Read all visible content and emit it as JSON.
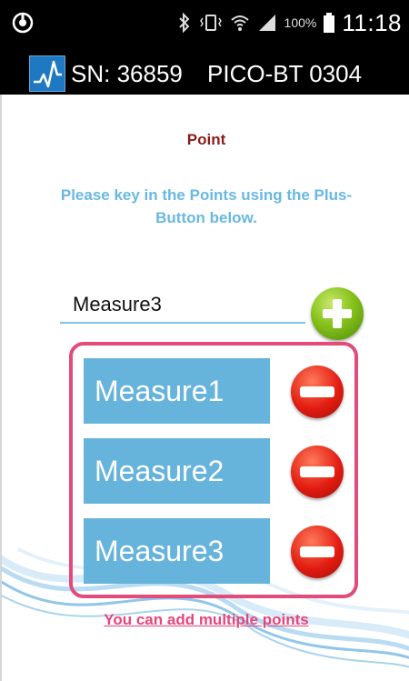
{
  "status_bar": {
    "left_icon": "nfc-icon",
    "icons": [
      "bluetooth-icon",
      "vibrate-icon",
      "wifi-icon",
      "signal-icon",
      "battery-icon"
    ],
    "battery": "100%",
    "time": "11:18"
  },
  "title_bar": {
    "logo_icon": "waveform-icon",
    "serial": "SN: 36859",
    "device": "PICO-BT 0304"
  },
  "main": {
    "heading": "Point",
    "instruction": "Please key in the Points using the Plus-Button below.",
    "input_value": "Measure3",
    "add_button_icon": "plus-icon",
    "points": [
      {
        "label": "Measure1",
        "remove_icon": "minus-icon"
      },
      {
        "label": "Measure2",
        "remove_icon": "minus-icon"
      },
      {
        "label": "Measure3",
        "remove_icon": "minus-icon"
      }
    ],
    "footer_note": "You can add multiple points"
  },
  "colors": {
    "heading": "#8b1c1c",
    "instruction": "#68b8e3",
    "point_fill": "#66b3dc",
    "box_border": "#e24b7a",
    "add_button": "#86c21b",
    "remove_button": "#e31d12"
  }
}
